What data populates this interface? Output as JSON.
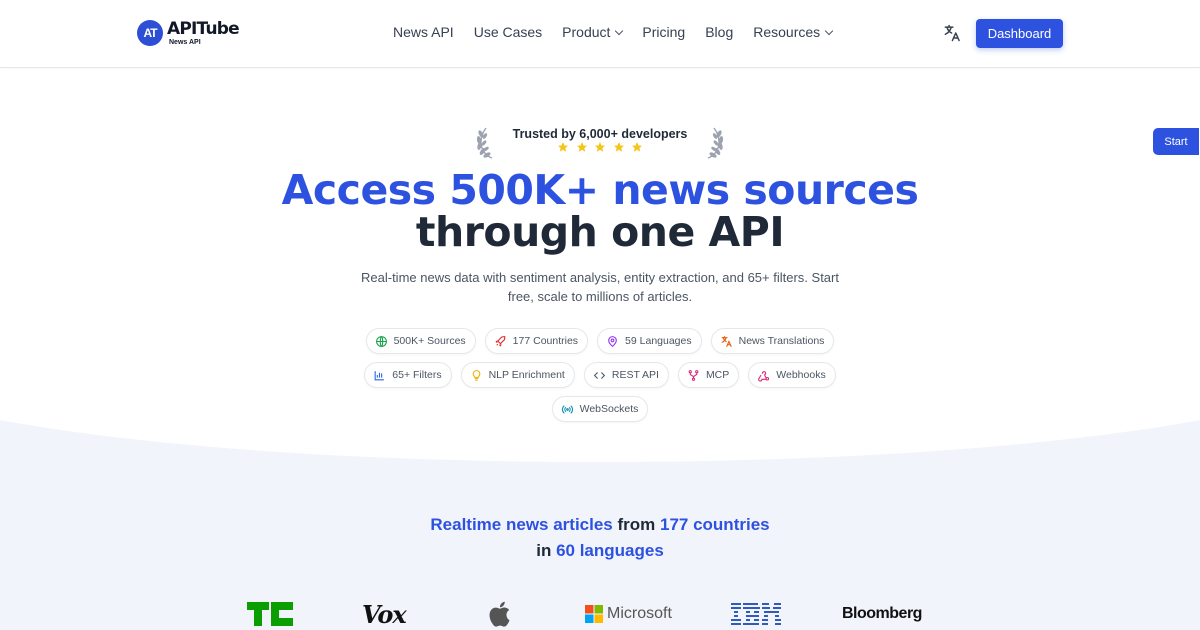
{
  "brand": {
    "name": "APITube",
    "subtitle": "News API",
    "mark": "AT"
  },
  "nav": {
    "items": [
      {
        "label": "News API",
        "has_dropdown": false
      },
      {
        "label": "Use Cases",
        "has_dropdown": false
      },
      {
        "label": "Product",
        "has_dropdown": true
      },
      {
        "label": "Pricing",
        "has_dropdown": false
      },
      {
        "label": "Blog",
        "has_dropdown": false
      },
      {
        "label": "Resources",
        "has_dropdown": true
      }
    ],
    "dashboard_label": "Dashboard",
    "language_icon": "translate-icon"
  },
  "start_tab": {
    "label": "Start"
  },
  "hero": {
    "trusted_text": "Trusted by 6,000+ developers",
    "stars": 5,
    "headline_line1": "Access 500K+ news sources",
    "headline_line2": "through one API",
    "lead": "Real-time news data with sentiment analysis, entity extraction, and 65+ filters. Start free, scale to millions of articles."
  },
  "features": [
    {
      "label": "500K+ Sources",
      "icon": "globe-icon",
      "color": "#16a34a"
    },
    {
      "label": "177 Countries",
      "icon": "rocket-icon",
      "color": "#dc2626"
    },
    {
      "label": "59 Languages",
      "icon": "map-pin-icon",
      "color": "#9333ea"
    },
    {
      "label": "News Translations",
      "icon": "translate-icon",
      "color": "#ea580c"
    },
    {
      "label": "65+ Filters",
      "icon": "bar-chart-icon",
      "color": "#2563eb"
    },
    {
      "label": "NLP Enrichment",
      "icon": "lightbulb-icon",
      "color": "#eab308"
    },
    {
      "label": "REST API",
      "icon": "code-icon",
      "color": "#4b5563"
    },
    {
      "label": "MCP",
      "icon": "network-icon",
      "color": "#db2777"
    },
    {
      "label": "Webhooks",
      "icon": "webhook-icon",
      "color": "#db2777"
    },
    {
      "label": "WebSockets",
      "icon": "broadcast-icon",
      "color": "#0891b2"
    }
  ],
  "coverage": {
    "part1": "Realtime news articles",
    "part2": " from ",
    "part3": "177 countries",
    "part4": "in ",
    "part5": "60 languages"
  },
  "press_logos": [
    {
      "name": "TechCrunch",
      "icon": "techcrunch-logo"
    },
    {
      "name": "Vox",
      "icon": "vox-logo"
    },
    {
      "name": "Apple",
      "icon": "apple-logo"
    },
    {
      "name": "Microsoft",
      "icon": "microsoft-logo"
    },
    {
      "name": "IBM",
      "icon": "ibm-logo"
    },
    {
      "name": "Bloomberg",
      "icon": "bloomberg-logo"
    }
  ],
  "colors": {
    "accent": "#2d52e0",
    "band": "#f1f4fb",
    "star": "#f5c518"
  }
}
